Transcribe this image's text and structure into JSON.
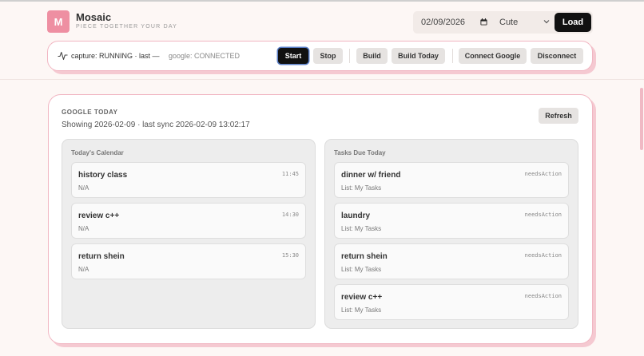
{
  "brand": {
    "initial": "M",
    "title": "Mosaic",
    "subtitle": "PIECE TOGETHER YOUR DAY"
  },
  "header": {
    "date": "02/09/2026",
    "theme": "Cute",
    "load_label": "Load"
  },
  "status": {
    "capture": "capture: RUNNING · last —",
    "google": "google: CONNECTED"
  },
  "controls": {
    "start": "Start",
    "stop": "Stop",
    "build": "Build",
    "build_today": "Build Today",
    "connect_google": "Connect Google",
    "disconnect": "Disconnect"
  },
  "google_today": {
    "label": "GOOGLE TODAY",
    "showing": "Showing 2026-02-09 · last sync 2026-02-09 13:02:17",
    "refresh_label": "Refresh",
    "calendar": {
      "title": "Today's Calendar",
      "items": [
        {
          "title": "history class",
          "sub": "N/A",
          "time": "11:45"
        },
        {
          "title": "review c++",
          "sub": "N/A",
          "time": "14:30"
        },
        {
          "title": "return shein",
          "sub": "N/A",
          "time": "15:30"
        }
      ]
    },
    "tasks": {
      "title": "Tasks Due Today",
      "items": [
        {
          "title": "dinner w/ friend",
          "sub": "List: My Tasks",
          "status": "needsAction"
        },
        {
          "title": "laundry",
          "sub": "List: My Tasks",
          "status": "needsAction"
        },
        {
          "title": "return shein",
          "sub": "List: My Tasks",
          "status": "needsAction"
        },
        {
          "title": "review c++",
          "sub": "List: My Tasks",
          "status": "needsAction"
        }
      ]
    }
  },
  "colors": {
    "accent": "#ee8fa2",
    "border_pink": "#f1b6c2",
    "background": "#fdf7f5"
  }
}
